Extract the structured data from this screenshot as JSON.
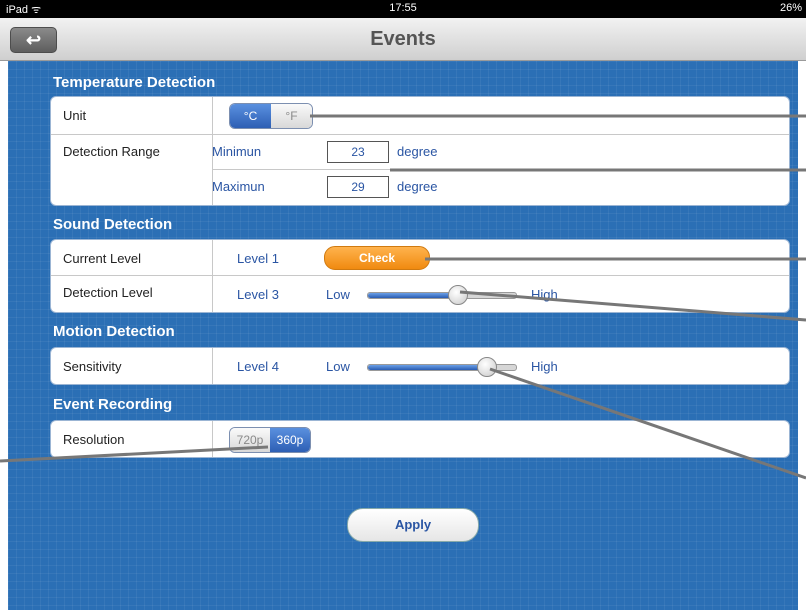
{
  "status": {
    "carrier": "iPad ᯤ",
    "time": "17:55",
    "battery": "26%"
  },
  "nav": {
    "title": "Events",
    "back_icon": "↩"
  },
  "temperature": {
    "title": "Temperature Detection",
    "unit_label": "Unit",
    "unit_c": "°C",
    "unit_f": "°F",
    "selected_unit": "°C",
    "range_label": "Detection Range",
    "min_label": "Minimun",
    "min_value": "23",
    "max_label": "Maximun",
    "max_value": "29",
    "unit_text": "degree"
  },
  "sound": {
    "title": "Sound Detection",
    "current_label": "Current Level",
    "current_value": "Level 1",
    "check_label": "Check",
    "detection_label": "Detection Level",
    "detection_value": "Level 3",
    "low": "Low",
    "high": "High",
    "detection_level_fraction": 0.6
  },
  "motion": {
    "title": "Motion Detection",
    "sensitivity_label": "Sensitivity",
    "sensitivity_value": "Level 4",
    "low": "Low",
    "high": "High",
    "sensitivity_fraction": 0.8
  },
  "recording": {
    "title": "Event Recording",
    "resolution_label": "Resolution",
    "res_720": "720p",
    "res_360": "360p",
    "selected": "360p"
  },
  "apply_label": "Apply",
  "colors": {
    "background": "#2b6fb5",
    "accent": "#2d5fb4",
    "check": "#f08a10"
  }
}
